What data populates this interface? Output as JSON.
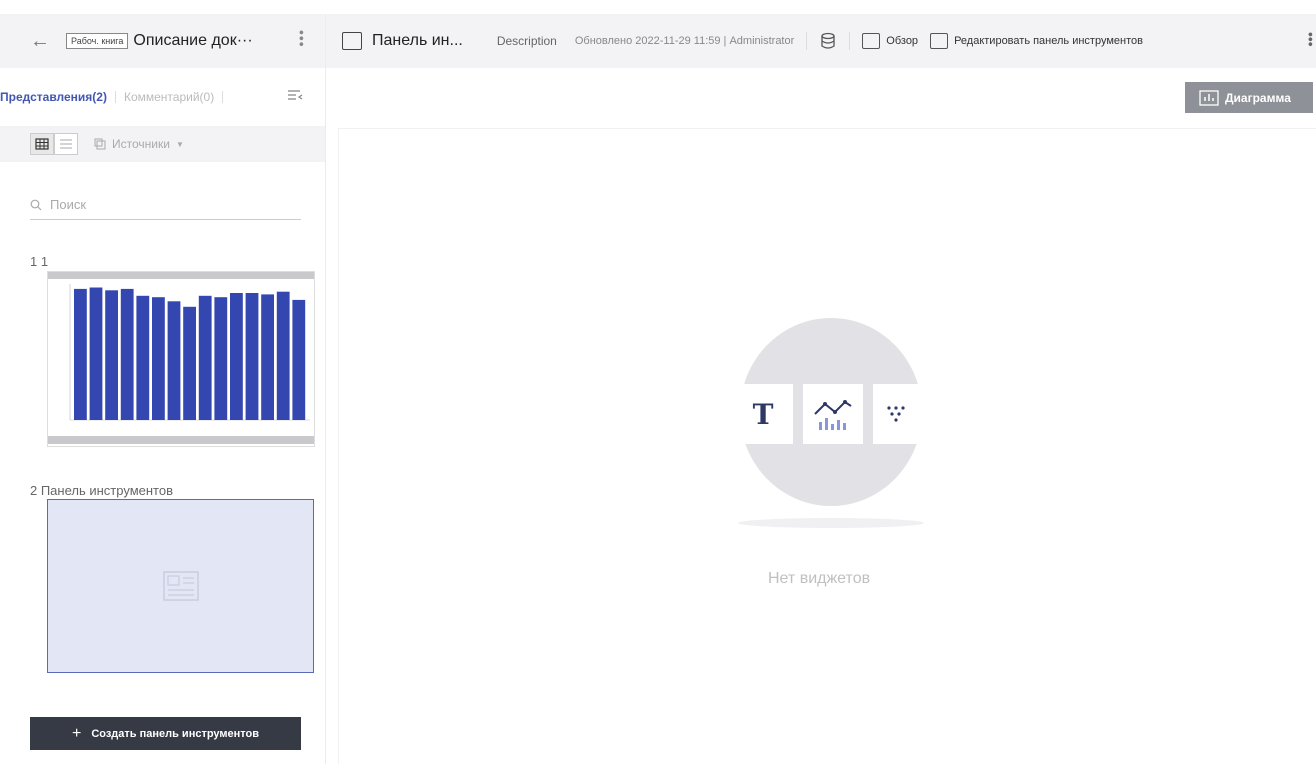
{
  "sidebar": {
    "back_icon": "arrow-left-icon",
    "workbook_tag": "Рабоч. книга",
    "doc_title": "Описание док···",
    "tabs": {
      "views": "Представления(2)",
      "comments": "Комментарий(0)"
    },
    "sources_label": "Источники",
    "search_placeholder": "Поиск",
    "items": [
      {
        "label": "1  1"
      },
      {
        "label": "2  Панель инструментов"
      }
    ],
    "thumb_chart": {
      "type": "bar",
      "values": [
        95,
        96,
        94,
        95,
        90,
        89,
        86,
        82,
        90,
        89,
        92,
        92,
        91,
        93,
        87
      ]
    },
    "create_button": "Создать панель инструментов"
  },
  "topbar": {
    "dashboard_title": "Панель ин...",
    "description": "Description",
    "updated": "Обновлено 2022-11-29 11:59 | Administrator",
    "overview_button": "Обзор",
    "edit_button": "Редактировать панель инструментов"
  },
  "main": {
    "chart_button": "Диаграмма",
    "empty_text": "Нет виджетов",
    "widget_text_glyph": "T"
  },
  "colors": {
    "accent": "#4257b2",
    "bar": "#3447b0",
    "dark_button": "#363a45"
  }
}
